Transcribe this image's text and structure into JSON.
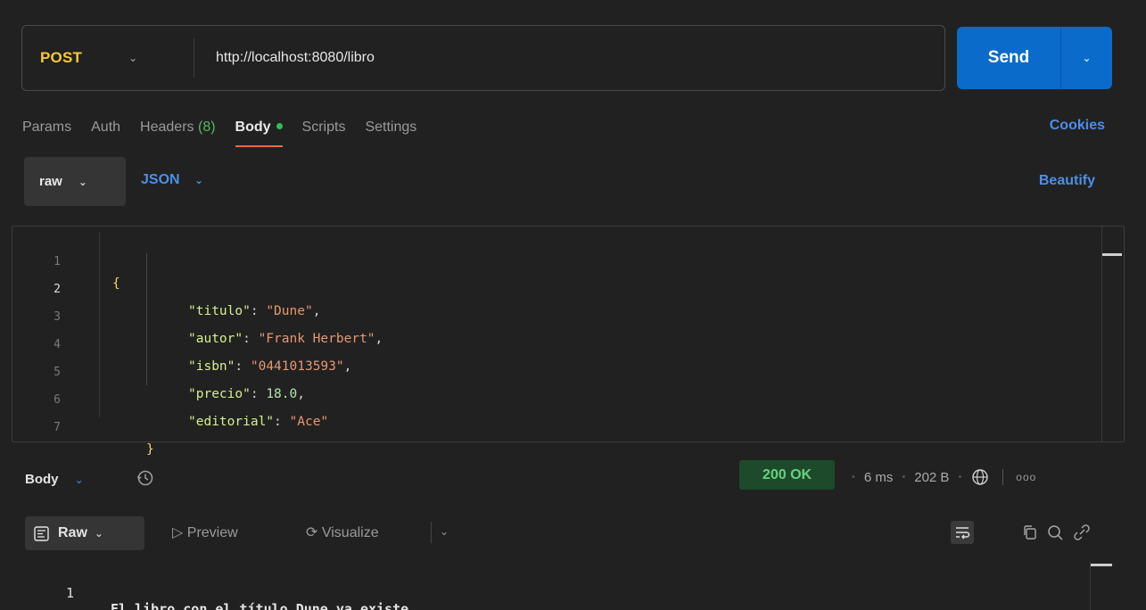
{
  "request": {
    "method": "POST",
    "url": "http://localhost:8080/libro",
    "send_label": "Send"
  },
  "tabs": [
    {
      "label": "Params"
    },
    {
      "label": "Auth"
    },
    {
      "label": "Headers",
      "count": "(8)"
    },
    {
      "label": "Body",
      "active": true
    },
    {
      "label": "Scripts"
    },
    {
      "label": "Settings"
    }
  ],
  "cookies_label": "Cookies",
  "body_mode": {
    "type": "raw",
    "format": "JSON",
    "beautify_label": "Beautify"
  },
  "editor": {
    "lines": [
      "1",
      "2",
      "3",
      "4",
      "5",
      "6",
      "7"
    ],
    "fields": [
      {
        "key": "\"titulo\"",
        "value": "\"Dune\"",
        "kind": "string"
      },
      {
        "key": "\"autor\"",
        "value": "\"Frank Herbert\"",
        "kind": "string"
      },
      {
        "key": "\"isbn\"",
        "value": "\"0441013593\"",
        "kind": "string"
      },
      {
        "key": "\"precio\"",
        "value": "18.0",
        "kind": "number"
      },
      {
        "key": "\"editorial\"",
        "value": "\"Ace\"",
        "kind": "string"
      }
    ],
    "open_brace": "{",
    "close_brace": "}"
  },
  "response": {
    "section_label": "Body",
    "status": "200 OK",
    "time": "6 ms",
    "size": "202 B",
    "view_mode": "Raw",
    "preview_label": "Preview",
    "visualize_label": "Visualize",
    "line_number": "1",
    "content": "El libro con el título Dune ya existe"
  },
  "colors": {
    "method": "#f8c932",
    "accent_blue": "#0b6bcb",
    "tab_underline": "#f26b3a",
    "status_ok": "#67d27f",
    "json_key": "#d7ee8e",
    "json_string": "#e59872"
  }
}
